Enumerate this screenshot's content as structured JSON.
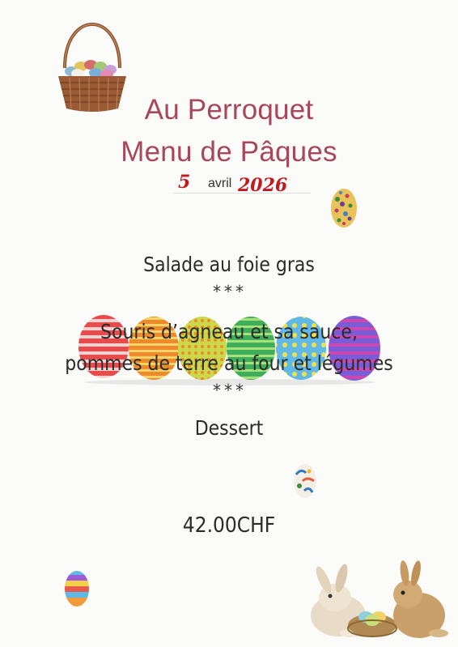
{
  "header": {
    "restaurant": "Au Perroquet",
    "menu_title": "Menu de Pâques",
    "date_day": "5",
    "date_month": "avril",
    "date_year": "2026"
  },
  "menu": {
    "starter": "Salade au foie gras",
    "separator1": "***",
    "main_line1": "Souris d’agneau et sa sauce,",
    "main_line2": "pommes de terre au four et légumes",
    "separator2": "***",
    "dessert": "Dessert"
  },
  "price": "42.00CHF",
  "icons": [
    "easter-basket-icon",
    "easter-egg-icon",
    "easter-eggs-row-icon",
    "bunnies-icon"
  ],
  "colors": {
    "title": "#a8475a",
    "handwriting": "#c01a1f",
    "text": "#2b2b2b"
  }
}
